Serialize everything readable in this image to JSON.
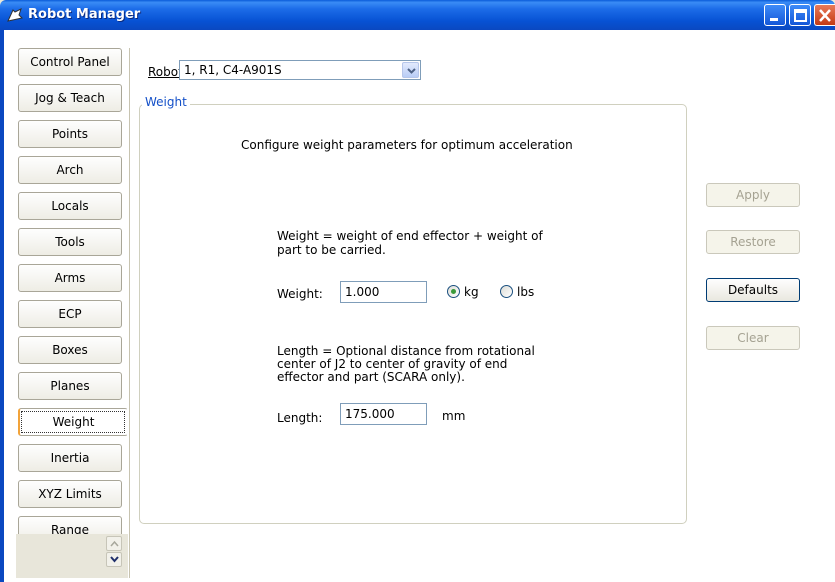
{
  "window": {
    "title": "Robot Manager"
  },
  "tabs": [
    "Control Panel",
    "Jog & Teach",
    "Points",
    "Arch",
    "Locals",
    "Tools",
    "Arms",
    "ECP",
    "Boxes",
    "Planes",
    "Weight",
    "Inertia",
    "XYZ Limits",
    "Range"
  ],
  "active_tab": "Weight",
  "robot": {
    "label": "Robot:",
    "value": "1, R1, C4-A901S"
  },
  "group": {
    "title": "Weight",
    "description": "Configure weight parameters for optimum acceleration",
    "weight_help": [
      "Weight = weight of end effector + weight of",
      "part to be carried."
    ],
    "weight_label": "Weight:",
    "weight_value": "1.000",
    "unit_kg": "kg",
    "unit_lbs": "lbs",
    "selected_unit": "kg",
    "length_help": [
      "Length = Optional distance from rotational",
      "center of J2 to center of gravity of end",
      "effector and part (SCARA only)."
    ],
    "length_label": "Length:",
    "length_value": "175.000",
    "length_unit": "mm"
  },
  "buttons": {
    "apply": "Apply",
    "restore": "Restore",
    "defaults": "Defaults",
    "clear": "Clear"
  },
  "colors": {
    "titlebar": "#0a48c0",
    "group_title": "#1450c8",
    "active_tab_accent": "#f2a33a"
  }
}
